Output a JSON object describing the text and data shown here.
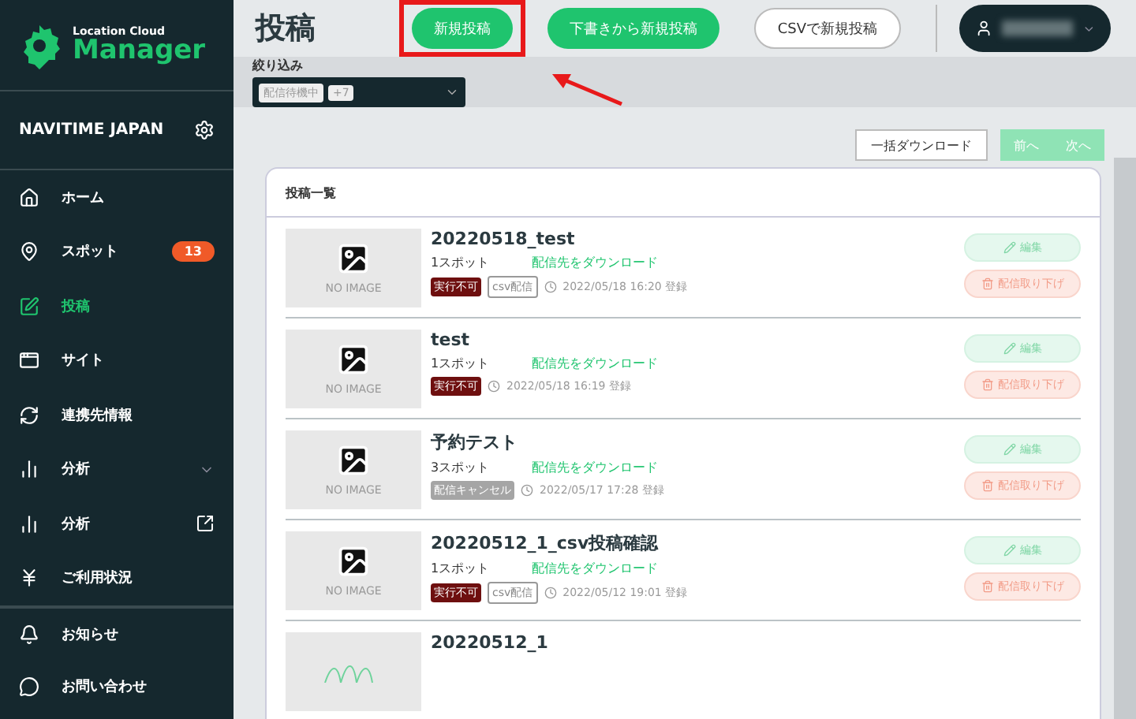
{
  "sidebar": {
    "logo": {
      "small": "Location Cloud",
      "big": "Manager"
    },
    "account": "NAVITIME JAPAN",
    "items": [
      {
        "label": "ホーム",
        "selected": false
      },
      {
        "label": "スポット",
        "selected": false,
        "badge": "13"
      },
      {
        "label": "投稿",
        "selected": true
      },
      {
        "label": "サイト",
        "selected": false
      },
      {
        "label": "連携先情報",
        "selected": false
      },
      {
        "label": "分析",
        "selected": false
      },
      {
        "label": "分析",
        "selected": false
      },
      {
        "label": "ご利用状況",
        "selected": false
      }
    ],
    "bottom_items": [
      {
        "label": "お知らせ",
        "selected": false
      },
      {
        "label": "お問い合わせ",
        "selected": false
      }
    ]
  },
  "header": {
    "title": "投稿",
    "buttons": [
      {
        "label": "新規投稿",
        "kind": "primary",
        "highlighted": true
      },
      {
        "label": "下書きから新規投稿",
        "kind": "primary",
        "highlighted": false
      },
      {
        "label": "CSVで新規投稿",
        "kind": "outline",
        "highlighted": false
      }
    ]
  },
  "filter": {
    "label": "絞り込み",
    "chips": [
      "配信待機中",
      "+7"
    ]
  },
  "toolbar": {
    "download": "一括ダウンロード",
    "pager": [
      {
        "label": "前へ",
        "disabled": true
      },
      {
        "label": "次へ",
        "disabled": true
      }
    ]
  },
  "list": {
    "title": "投稿一覧",
    "posts": [
      {
        "image_label": "NO IMAGE",
        "title": "20220518_test",
        "spots": "1スポット",
        "link": "配信先をダウンロード",
        "tags": [
          {
            "label": "実行不可",
            "kind": "danger"
          },
          {
            "label": "csv配信",
            "kind": "outline"
          }
        ],
        "date": "2022/05/18 16:20 登録",
        "actions": [
          "編集",
          "配信取り下げ"
        ]
      },
      {
        "image_label": "NO IMAGE",
        "title": "test",
        "spots": "1スポット",
        "link": "配信先をダウンロード",
        "tags": [
          {
            "label": "実行不可",
            "kind": "danger"
          }
        ],
        "date": "2022/05/18 16:19 登録",
        "actions": [
          "編集",
          "配信取り下げ"
        ]
      },
      {
        "image_label": "NO IMAGE",
        "title": "予約テスト",
        "spots": "3スポット",
        "link": "配信先をダウンロード",
        "tags": [
          {
            "label": "配信キャンセル",
            "kind": "muted"
          }
        ],
        "date": "2022/05/17 17:28 登録",
        "actions": [
          "編集",
          "配信取り下げ"
        ]
      },
      {
        "image_label": "NO IMAGE",
        "title": "20220512_1_csv投稿確認",
        "spots": "1スポット",
        "link": "配信先をダウンロード",
        "tags": [
          {
            "label": "実行不可",
            "kind": "danger"
          },
          {
            "label": "csv配信",
            "kind": "outline"
          }
        ],
        "date": "2022/05/12 19:01 登録",
        "actions": [
          "編集",
          "配信取り下げ"
        ]
      },
      {
        "title": "20220512_1"
      }
    ]
  }
}
